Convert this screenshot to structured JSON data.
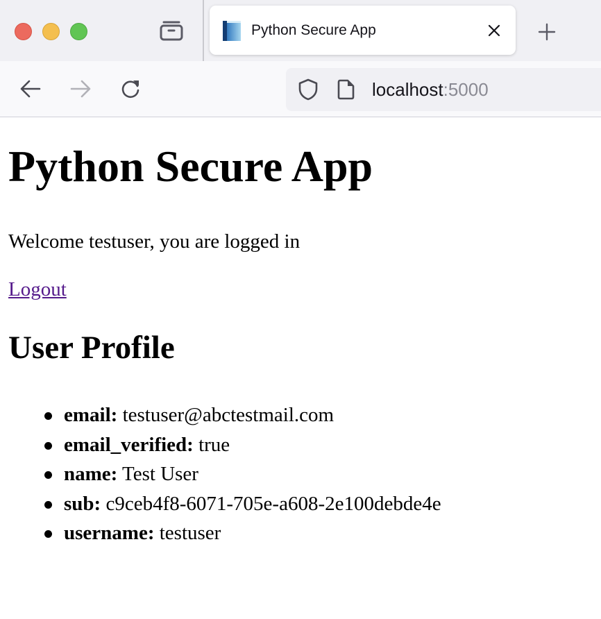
{
  "browser": {
    "window_controls": [
      "close",
      "minimize",
      "maximize"
    ],
    "tab": {
      "title": "Python Secure App",
      "favicon": "book-icon"
    },
    "url": {
      "host": "localhost",
      "port": ":5000"
    },
    "colors": {
      "close": "#ec6a5e",
      "minimize": "#f4bf4f",
      "maximize": "#61c554"
    }
  },
  "page": {
    "title": "Python Secure App",
    "welcome": "Welcome testuser, you are logged in",
    "logout_label": "Logout",
    "profile_heading": "User Profile",
    "profile": [
      {
        "key": "email:",
        "value": " testuser@abctestmail.com"
      },
      {
        "key": "email_verified:",
        "value": " true"
      },
      {
        "key": "name:",
        "value": " Test User"
      },
      {
        "key": "sub:",
        "value": " c9ceb4f8-6071-705e-a608-2e100debde4e"
      },
      {
        "key": "username:",
        "value": " testuser"
      }
    ],
    "link_color": "#551a8b"
  }
}
